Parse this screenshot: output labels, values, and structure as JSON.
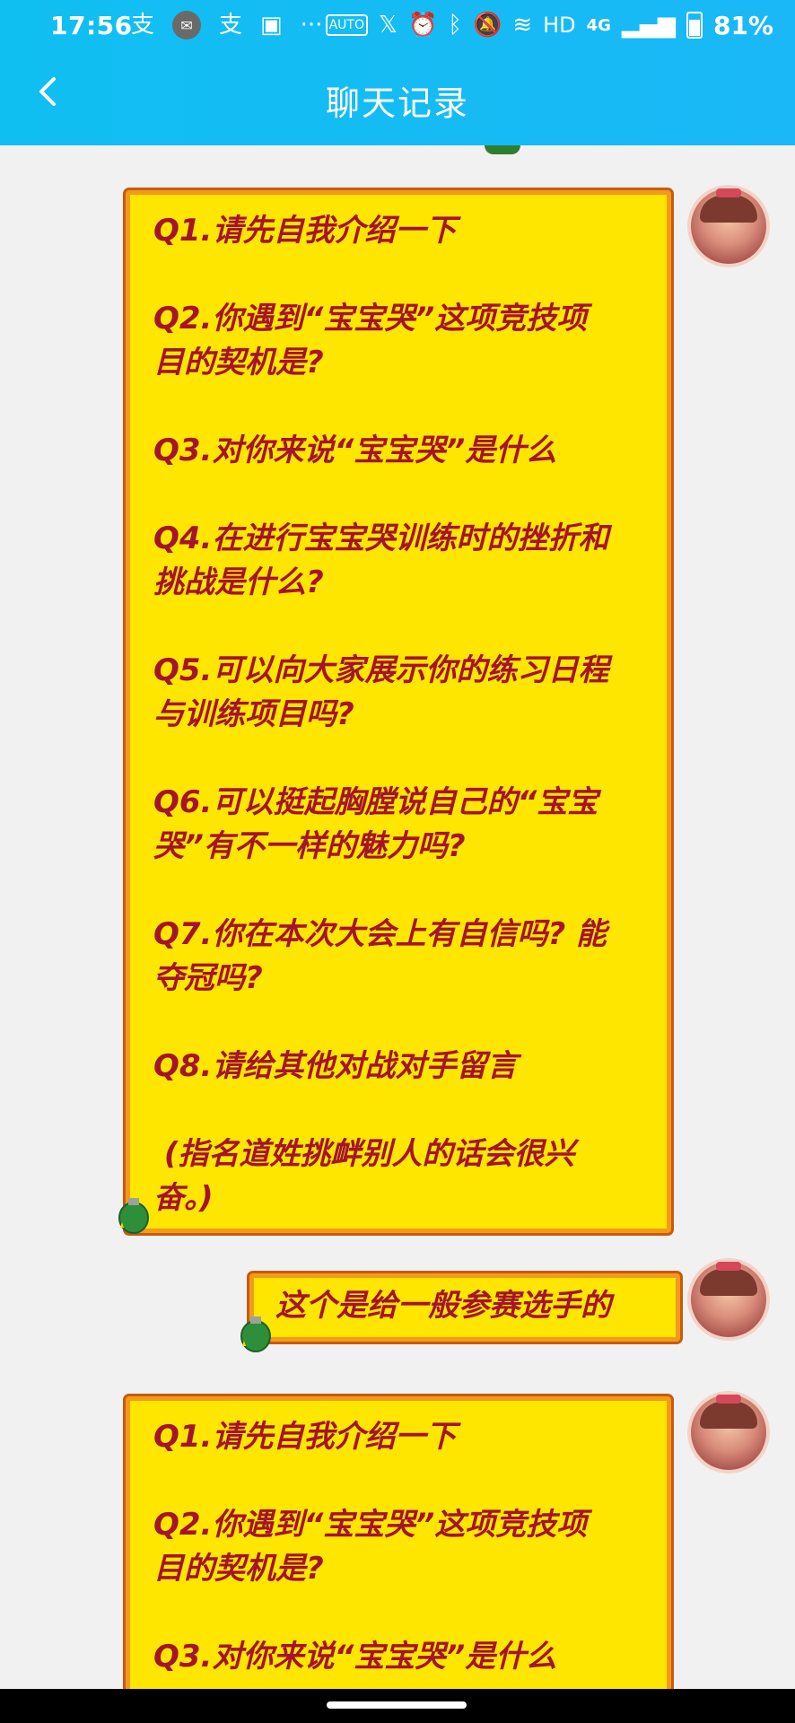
{
  "status_bar": {
    "time": "17:56",
    "battery": "81%",
    "network": "HD",
    "net_type": "4G"
  },
  "header": {
    "title": "聊天记录",
    "back_icon": "chevron-left-icon"
  },
  "messages": [
    {
      "text": "Q1.请先自我介绍一下\n\nQ2.你遇到“宝宝哭”这项竞技项\n目的契机是?\n\nQ3.对你来说“宝宝哭”是什么\n\nQ4.在进行宝宝哭训练时的挫折和\n挑战是什么?\n\nQ5.可以向大家展示你的练习日程\n与训练项目吗?\n\nQ6.可以挺起胸膛说自己的“宝宝\n哭”有不一样的魅力吗?\n\nQ7.你在本次大会上有自信吗? 能\n夺冠吗?\n\nQ8.请给其他对战对手留言\n\n (指名道姓挑衅别人的话会很兴\n奋。)"
    },
    {
      "text": "这个是给一般参赛选手的"
    },
    {
      "text": "Q1.请先自我介绍一下\n\nQ2.你遇到“宝宝哭”这项竞技项\n目的契机是?\n\nQ3.对你来说“宝宝哭”是什么"
    }
  ],
  "colors": {
    "header_bg": "#12bdf4",
    "bubble_fill": "#ffe600",
    "bubble_border": "#f39a1c",
    "bubble_text": "#a4142c"
  }
}
